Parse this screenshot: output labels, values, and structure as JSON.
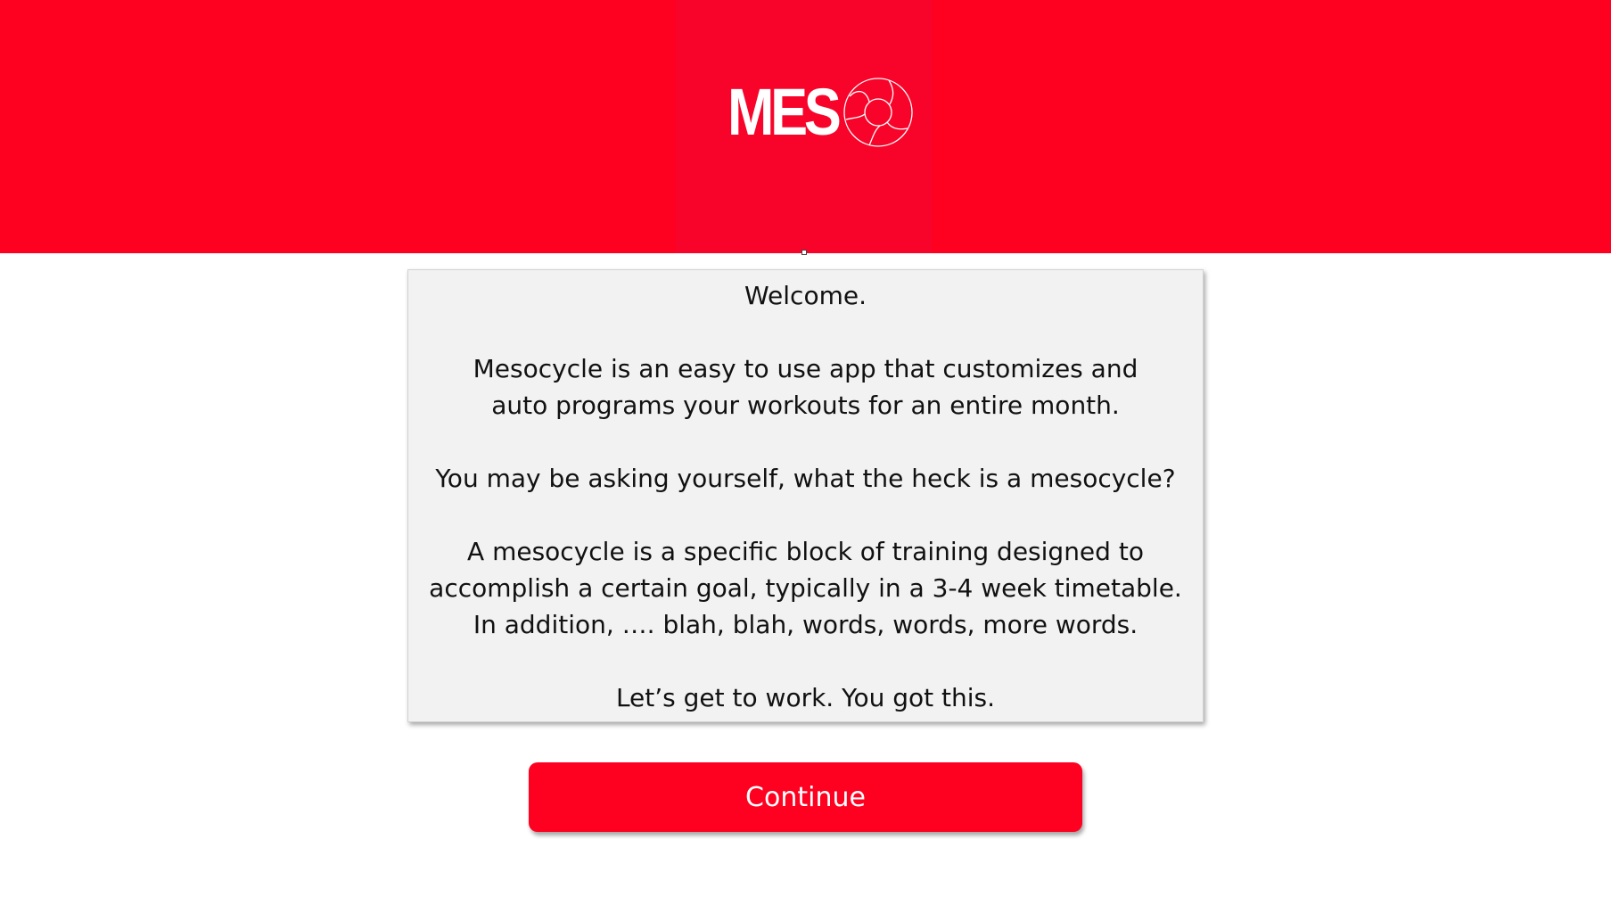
{
  "header": {
    "logo_text": "MES",
    "logo_icon": "cycle-ring-icon",
    "background_color": "#fe0020"
  },
  "card": {
    "paragraphs": [
      "Welcome.",
      "Mesocycle is an easy to use app that customizes and auto programs your workouts for an entire month.",
      "You may be asking yourself, what the heck is a mesocycle?",
      "A mesocycle is a specific block of training designed to accomplish a certain goal, typically in a 3-4 week timetable. In addition, …. blah, blah, words, words, more words.",
      "Let’s get to work. You got this."
    ],
    "background_color": "#f2f2f2"
  },
  "continue_button": {
    "label": "Continue",
    "color": "#fe0020"
  }
}
